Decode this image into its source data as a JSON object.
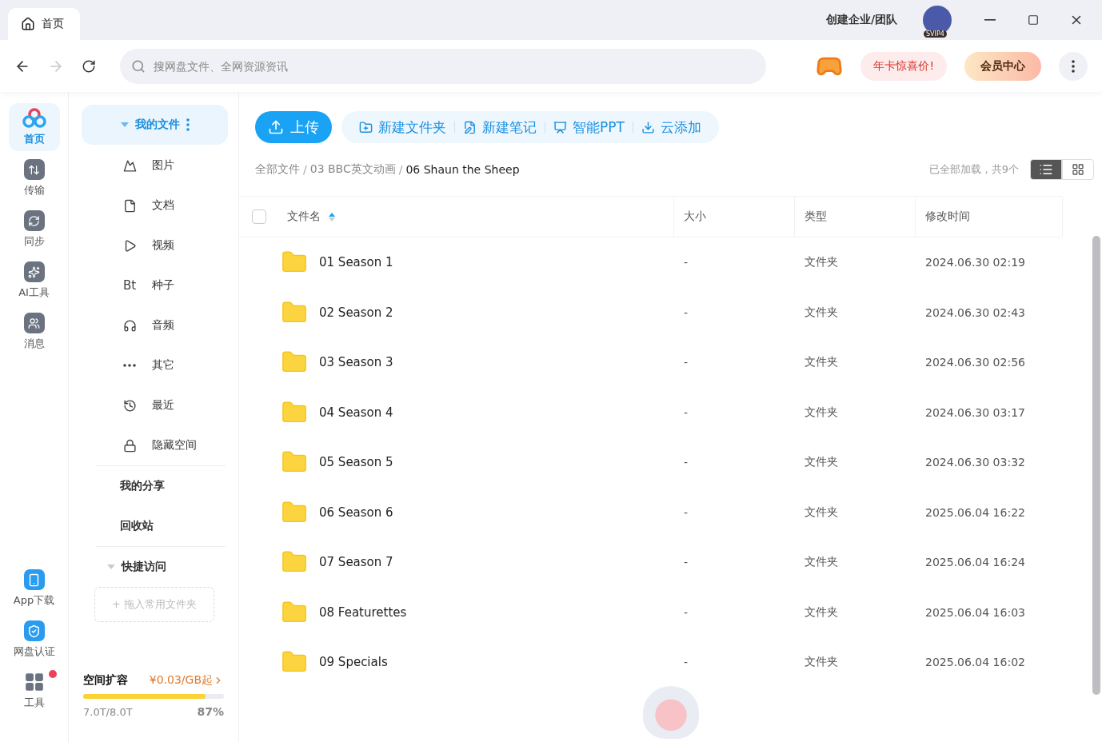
{
  "tabs": [
    {
      "label": "首页",
      "selected": true
    }
  ],
  "title_bar": {
    "team": "创建企业/团队",
    "badge": "SVIP4"
  },
  "toolbar": {
    "search": {
      "placeholder": "搜网盘文件、全网资源资讯"
    },
    "promo": "年卡惊喜价!",
    "vip": "会员中心"
  },
  "rail": {
    "items": [
      {
        "label": "首页",
        "selected": true
      },
      {
        "label": "传输",
        "selected": false
      },
      {
        "label": "同步",
        "selected": false
      },
      {
        "label": "AI工具",
        "selected": false
      },
      {
        "label": "消息",
        "selected": false
      }
    ],
    "bottom": [
      {
        "label": "App下载",
        "dot": false
      },
      {
        "label": "网盘认证",
        "dot": false
      },
      {
        "label": "工具",
        "dot": true
      }
    ]
  },
  "nav": {
    "header": {
      "label": "我的文件",
      "expanded": true
    },
    "categories": [
      {
        "label": "图片"
      },
      {
        "label": "文档"
      },
      {
        "label": "视频"
      },
      {
        "label": "种子",
        "glyph": "Bt"
      },
      {
        "label": "音频"
      },
      {
        "label": "其它"
      },
      {
        "label": "最近"
      },
      {
        "label": "隐藏空间"
      }
    ],
    "links": [
      "我的分享",
      "回收站"
    ],
    "quick_access": {
      "title": "快捷访问",
      "expanded": true,
      "placeholder": "+ 拖入常用文件夹"
    },
    "storage": {
      "title": "空间扩容",
      "price": "¥0.03/GB起",
      "used": "7.0T/8.0T",
      "percent": "87%",
      "level": 0.87
    }
  },
  "actions": {
    "upload": "上传",
    "buttons": [
      "新建文件夹",
      "新建笔记",
      "智能PPT",
      "云添加"
    ]
  },
  "breadcrumb": {
    "separator": "/",
    "items": [
      "全部文件",
      "03 BBC英文动画",
      "06 Shaun the Sheep"
    ]
  },
  "status": "已全部加载，共9个",
  "views": [
    {
      "kind": "list",
      "selected": true
    },
    {
      "kind": "grid",
      "selected": false
    }
  ],
  "table": {
    "select_all": false,
    "columns": [
      {
        "label": "文件名",
        "sort_ascending": true
      },
      {
        "label": "大小"
      },
      {
        "label": "类型"
      },
      {
        "label": "修改时间"
      }
    ],
    "rows": [
      {
        "name": "01 Season 1",
        "size": "-",
        "type": "文件夹",
        "modified": "2024.06.30 02:19"
      },
      {
        "name": "02 Season 2",
        "size": "-",
        "type": "文件夹",
        "modified": "2024.06.30 02:43"
      },
      {
        "name": "03 Season 3",
        "size": "-",
        "type": "文件夹",
        "modified": "2024.06.30 02:56"
      },
      {
        "name": "04 Season 4",
        "size": "-",
        "type": "文件夹",
        "modified": "2024.06.30 03:17"
      },
      {
        "name": "05 Season 5",
        "size": "-",
        "type": "文件夹",
        "modified": "2024.06.30 03:32"
      },
      {
        "name": "06 Season 6",
        "size": "-",
        "type": "文件夹",
        "modified": "2025.06.04 16:22"
      },
      {
        "name": "07 Season 7",
        "size": "-",
        "type": "文件夹",
        "modified": "2025.06.04 16:24"
      },
      {
        "name": "08 Featurettes",
        "size": "-",
        "type": "文件夹",
        "modified": "2025.06.04 16:03"
      },
      {
        "name": "09 Specials",
        "size": "-",
        "type": "文件夹",
        "modified": "2025.06.04 16:02"
      }
    ]
  }
}
